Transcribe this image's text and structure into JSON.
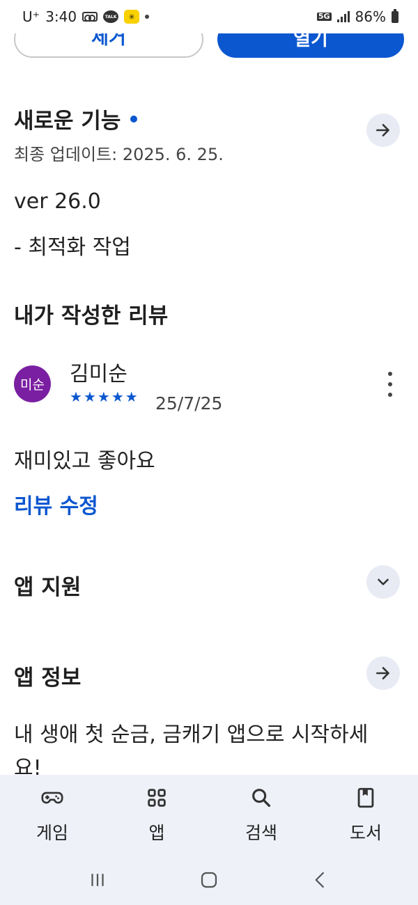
{
  "status_bar": {
    "carrier": "U⁺",
    "time": "3:40",
    "talk_label": "TALK",
    "network": "5G",
    "battery": "86%"
  },
  "top_buttons": {
    "uninstall_label": "제거",
    "open_label": "열기"
  },
  "whats_new": {
    "title": "새로운 기능",
    "updated": "최종 업데이트: 2025. 6. 25.",
    "version": "ver 26.0",
    "note": "- 최적화 작업"
  },
  "my_review": {
    "title": "내가 작성한 리뷰",
    "avatar_text": "미순",
    "avatar_color": "#7b1fa2",
    "reviewer": "김미순",
    "rating": 5,
    "rating_max": 5,
    "date": "25/7/25",
    "text": "재미있고 좋아요",
    "edit_label": "리뷰 수정"
  },
  "app_support": {
    "title": "앱 지원"
  },
  "app_info": {
    "title": "앱 정보",
    "description": "내 생애 첫 순금, 금캐기 앱으로 시작하세요!"
  },
  "bottom_nav": {
    "items": [
      {
        "label": "게임",
        "icon": "gamepad-icon"
      },
      {
        "label": "앱",
        "icon": "apps-grid-icon"
      },
      {
        "label": "검색",
        "icon": "search-icon"
      },
      {
        "label": "도서",
        "icon": "book-icon"
      }
    ]
  },
  "colors": {
    "accent": "#0b57d0",
    "nav_background": "#eef1f8"
  }
}
